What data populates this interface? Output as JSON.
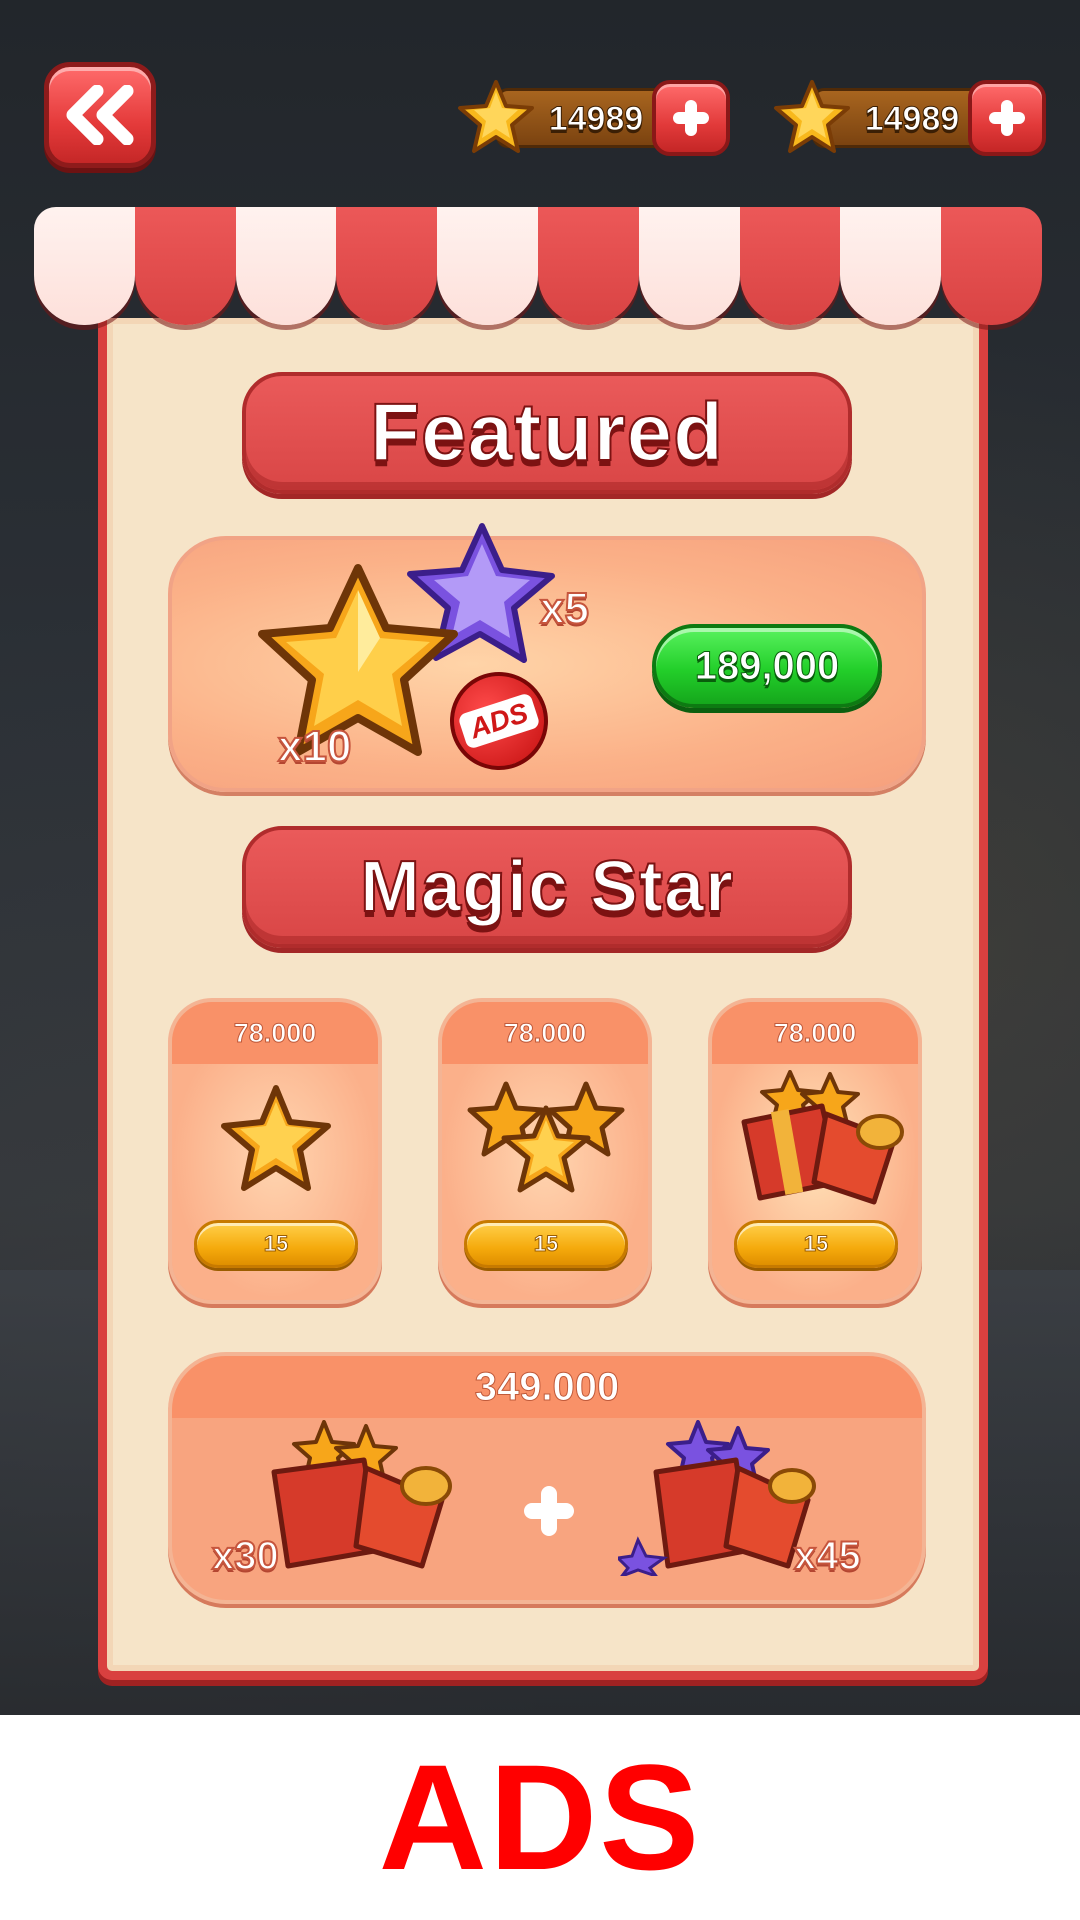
{
  "top_bar": {
    "back_icon": "double-chevron-left-icon",
    "currencies": [
      {
        "icon": "gold-star-icon",
        "amount": "14989",
        "add_icon": "plus-icon"
      },
      {
        "icon": "gold-star-icon",
        "amount": "14989",
        "add_icon": "plus-icon"
      }
    ]
  },
  "featured": {
    "title": "Featured",
    "gold_qty": "x10",
    "purple_qty": "x5",
    "ads_badge": "ADS",
    "price": "189,000"
  },
  "magic_star": {
    "title": "Magic Star",
    "items": [
      {
        "price": "78.000",
        "cost": "15",
        "icon": "single-gold-star-icon"
      },
      {
        "price": "78.000",
        "cost": "15",
        "icon": "three-gold-stars-icon"
      },
      {
        "price": "78.000",
        "cost": "15",
        "icon": "gift-box-stars-icon"
      }
    ]
  },
  "bundle": {
    "price": "349.000",
    "left_qty": "x30",
    "right_qty": "x45",
    "plus_icon": "plus-icon"
  },
  "footer": {
    "label": "ADS"
  },
  "colors": {
    "brand_red": "#d94646",
    "panel_cream": "#f6e4c8",
    "card_peach": "#f8a47f",
    "buy_green": "#23cf2a",
    "cost_yellow": "#f5aa0c",
    "ads_red": "#ff0000"
  }
}
